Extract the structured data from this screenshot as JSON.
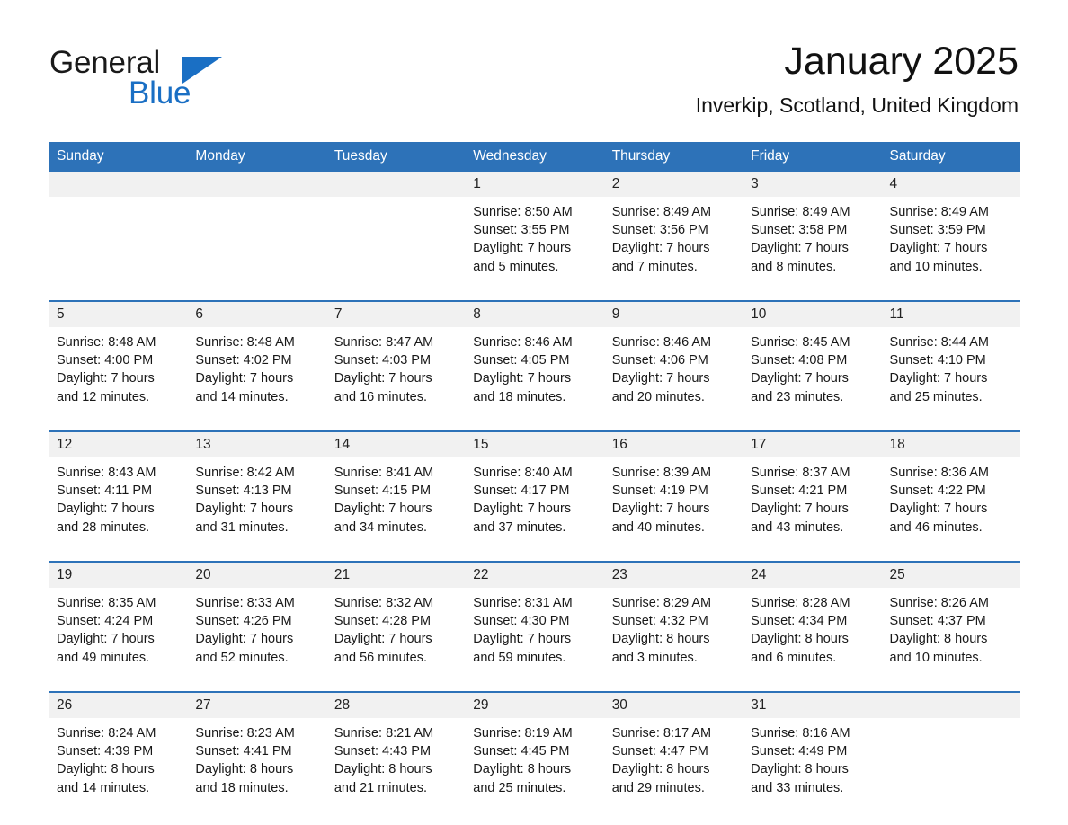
{
  "brand": {
    "name_part1": "General",
    "name_part2": "Blue",
    "accent_color": "#1a6fc4",
    "logo_icon": "triangle-flag-icon"
  },
  "header": {
    "title": "January 2025",
    "subtitle": "Inverkip, Scotland, United Kingdom",
    "header_bg_color": "#2d72b8",
    "week_rule_color": "#2d72b8",
    "daynum_bg_color": "#f1f1f1"
  },
  "weekday_headers": [
    "Sunday",
    "Monday",
    "Tuesday",
    "Wednesday",
    "Thursday",
    "Friday",
    "Saturday"
  ],
  "weeks": [
    {
      "days": [
        {
          "num": "",
          "sunrise": "",
          "sunset": "",
          "daylight1": "",
          "daylight2": "",
          "empty": true
        },
        {
          "num": "",
          "sunrise": "",
          "sunset": "",
          "daylight1": "",
          "daylight2": "",
          "empty": true
        },
        {
          "num": "",
          "sunrise": "",
          "sunset": "",
          "daylight1": "",
          "daylight2": "",
          "empty": true
        },
        {
          "num": "1",
          "sunrise": "Sunrise: 8:50 AM",
          "sunset": "Sunset: 3:55 PM",
          "daylight1": "Daylight: 7 hours",
          "daylight2": "and 5 minutes.",
          "empty": false
        },
        {
          "num": "2",
          "sunrise": "Sunrise: 8:49 AM",
          "sunset": "Sunset: 3:56 PM",
          "daylight1": "Daylight: 7 hours",
          "daylight2": "and 7 minutes.",
          "empty": false
        },
        {
          "num": "3",
          "sunrise": "Sunrise: 8:49 AM",
          "sunset": "Sunset: 3:58 PM",
          "daylight1": "Daylight: 7 hours",
          "daylight2": "and 8 minutes.",
          "empty": false
        },
        {
          "num": "4",
          "sunrise": "Sunrise: 8:49 AM",
          "sunset": "Sunset: 3:59 PM",
          "daylight1": "Daylight: 7 hours",
          "daylight2": "and 10 minutes.",
          "empty": false
        }
      ]
    },
    {
      "days": [
        {
          "num": "5",
          "sunrise": "Sunrise: 8:48 AM",
          "sunset": "Sunset: 4:00 PM",
          "daylight1": "Daylight: 7 hours",
          "daylight2": "and 12 minutes.",
          "empty": false
        },
        {
          "num": "6",
          "sunrise": "Sunrise: 8:48 AM",
          "sunset": "Sunset: 4:02 PM",
          "daylight1": "Daylight: 7 hours",
          "daylight2": "and 14 minutes.",
          "empty": false
        },
        {
          "num": "7",
          "sunrise": "Sunrise: 8:47 AM",
          "sunset": "Sunset: 4:03 PM",
          "daylight1": "Daylight: 7 hours",
          "daylight2": "and 16 minutes.",
          "empty": false
        },
        {
          "num": "8",
          "sunrise": "Sunrise: 8:46 AM",
          "sunset": "Sunset: 4:05 PM",
          "daylight1": "Daylight: 7 hours",
          "daylight2": "and 18 minutes.",
          "empty": false
        },
        {
          "num": "9",
          "sunrise": "Sunrise: 8:46 AM",
          "sunset": "Sunset: 4:06 PM",
          "daylight1": "Daylight: 7 hours",
          "daylight2": "and 20 minutes.",
          "empty": false
        },
        {
          "num": "10",
          "sunrise": "Sunrise: 8:45 AM",
          "sunset": "Sunset: 4:08 PM",
          "daylight1": "Daylight: 7 hours",
          "daylight2": "and 23 minutes.",
          "empty": false
        },
        {
          "num": "11",
          "sunrise": "Sunrise: 8:44 AM",
          "sunset": "Sunset: 4:10 PM",
          "daylight1": "Daylight: 7 hours",
          "daylight2": "and 25 minutes.",
          "empty": false
        }
      ]
    },
    {
      "days": [
        {
          "num": "12",
          "sunrise": "Sunrise: 8:43 AM",
          "sunset": "Sunset: 4:11 PM",
          "daylight1": "Daylight: 7 hours",
          "daylight2": "and 28 minutes.",
          "empty": false
        },
        {
          "num": "13",
          "sunrise": "Sunrise: 8:42 AM",
          "sunset": "Sunset: 4:13 PM",
          "daylight1": "Daylight: 7 hours",
          "daylight2": "and 31 minutes.",
          "empty": false
        },
        {
          "num": "14",
          "sunrise": "Sunrise: 8:41 AM",
          "sunset": "Sunset: 4:15 PM",
          "daylight1": "Daylight: 7 hours",
          "daylight2": "and 34 minutes.",
          "empty": false
        },
        {
          "num": "15",
          "sunrise": "Sunrise: 8:40 AM",
          "sunset": "Sunset: 4:17 PM",
          "daylight1": "Daylight: 7 hours",
          "daylight2": "and 37 minutes.",
          "empty": false
        },
        {
          "num": "16",
          "sunrise": "Sunrise: 8:39 AM",
          "sunset": "Sunset: 4:19 PM",
          "daylight1": "Daylight: 7 hours",
          "daylight2": "and 40 minutes.",
          "empty": false
        },
        {
          "num": "17",
          "sunrise": "Sunrise: 8:37 AM",
          "sunset": "Sunset: 4:21 PM",
          "daylight1": "Daylight: 7 hours",
          "daylight2": "and 43 minutes.",
          "empty": false
        },
        {
          "num": "18",
          "sunrise": "Sunrise: 8:36 AM",
          "sunset": "Sunset: 4:22 PM",
          "daylight1": "Daylight: 7 hours",
          "daylight2": "and 46 minutes.",
          "empty": false
        }
      ]
    },
    {
      "days": [
        {
          "num": "19",
          "sunrise": "Sunrise: 8:35 AM",
          "sunset": "Sunset: 4:24 PM",
          "daylight1": "Daylight: 7 hours",
          "daylight2": "and 49 minutes.",
          "empty": false
        },
        {
          "num": "20",
          "sunrise": "Sunrise: 8:33 AM",
          "sunset": "Sunset: 4:26 PM",
          "daylight1": "Daylight: 7 hours",
          "daylight2": "and 52 minutes.",
          "empty": false
        },
        {
          "num": "21",
          "sunrise": "Sunrise: 8:32 AM",
          "sunset": "Sunset: 4:28 PM",
          "daylight1": "Daylight: 7 hours",
          "daylight2": "and 56 minutes.",
          "empty": false
        },
        {
          "num": "22",
          "sunrise": "Sunrise: 8:31 AM",
          "sunset": "Sunset: 4:30 PM",
          "daylight1": "Daylight: 7 hours",
          "daylight2": "and 59 minutes.",
          "empty": false
        },
        {
          "num": "23",
          "sunrise": "Sunrise: 8:29 AM",
          "sunset": "Sunset: 4:32 PM",
          "daylight1": "Daylight: 8 hours",
          "daylight2": "and 3 minutes.",
          "empty": false
        },
        {
          "num": "24",
          "sunrise": "Sunrise: 8:28 AM",
          "sunset": "Sunset: 4:34 PM",
          "daylight1": "Daylight: 8 hours",
          "daylight2": "and 6 minutes.",
          "empty": false
        },
        {
          "num": "25",
          "sunrise": "Sunrise: 8:26 AM",
          "sunset": "Sunset: 4:37 PM",
          "daylight1": "Daylight: 8 hours",
          "daylight2": "and 10 minutes.",
          "empty": false
        }
      ]
    },
    {
      "days": [
        {
          "num": "26",
          "sunrise": "Sunrise: 8:24 AM",
          "sunset": "Sunset: 4:39 PM",
          "daylight1": "Daylight: 8 hours",
          "daylight2": "and 14 minutes.",
          "empty": false
        },
        {
          "num": "27",
          "sunrise": "Sunrise: 8:23 AM",
          "sunset": "Sunset: 4:41 PM",
          "daylight1": "Daylight: 8 hours",
          "daylight2": "and 18 minutes.",
          "empty": false
        },
        {
          "num": "28",
          "sunrise": "Sunrise: 8:21 AM",
          "sunset": "Sunset: 4:43 PM",
          "daylight1": "Daylight: 8 hours",
          "daylight2": "and 21 minutes.",
          "empty": false
        },
        {
          "num": "29",
          "sunrise": "Sunrise: 8:19 AM",
          "sunset": "Sunset: 4:45 PM",
          "daylight1": "Daylight: 8 hours",
          "daylight2": "and 25 minutes.",
          "empty": false
        },
        {
          "num": "30",
          "sunrise": "Sunrise: 8:17 AM",
          "sunset": "Sunset: 4:47 PM",
          "daylight1": "Daylight: 8 hours",
          "daylight2": "and 29 minutes.",
          "empty": false
        },
        {
          "num": "31",
          "sunrise": "Sunrise: 8:16 AM",
          "sunset": "Sunset: 4:49 PM",
          "daylight1": "Daylight: 8 hours",
          "daylight2": "and 33 minutes.",
          "empty": false
        },
        {
          "num": "",
          "sunrise": "",
          "sunset": "",
          "daylight1": "",
          "daylight2": "",
          "empty": true
        }
      ]
    }
  ]
}
